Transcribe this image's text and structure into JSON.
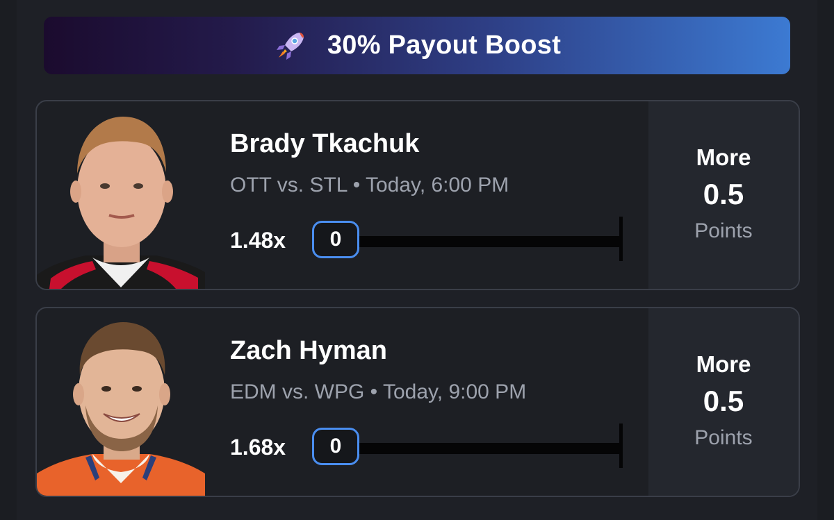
{
  "boost": {
    "icon": "rocket-icon",
    "label": "30% Payout Boost"
  },
  "picks": [
    {
      "player": "Brady Tkachuk",
      "matchup": "OTT vs. STL • Today, 6:00 PM",
      "multiplier": "1.48x",
      "count": "0",
      "direction": "More",
      "line": "0.5",
      "stat": "Points"
    },
    {
      "player": "Zach Hyman",
      "matchup": "EDM vs. WPG • Today, 9:00 PM",
      "multiplier": "1.68x",
      "count": "0",
      "direction": "More",
      "line": "0.5",
      "stat": "Points"
    }
  ],
  "colors": {
    "background": "#1e2026",
    "card": "#1d1f24",
    "side_panel": "#24272e",
    "accent_blue": "#4a8ef0",
    "muted_text": "#9da2ad",
    "boost_gradient_start": "#1b0b2e",
    "boost_gradient_end": "#3c7ad2"
  }
}
